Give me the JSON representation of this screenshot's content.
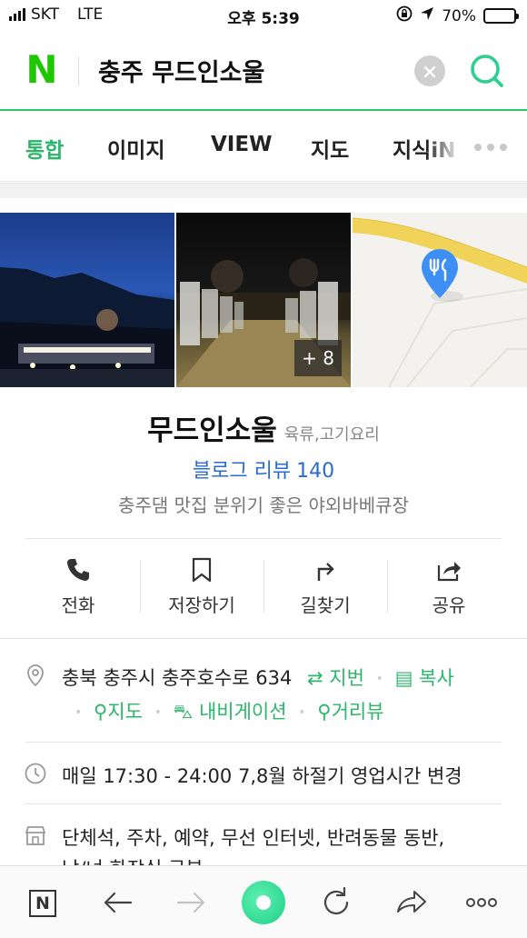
{
  "status_bar": {
    "carrier": "SKT",
    "network": "LTE",
    "time": "오후 5:39",
    "battery": "70%",
    "battery_level": 0.7
  },
  "search": {
    "logo": "N",
    "query": "충주 무드인소울"
  },
  "tabs": [
    {
      "label": "통합",
      "active": true
    },
    {
      "label": "이미지"
    },
    {
      "label": "VIEW"
    },
    {
      "label": "지도"
    },
    {
      "label": "지식iN"
    }
  ],
  "photos": {
    "more_count": "+ 8"
  },
  "place": {
    "name": "무드인소울",
    "category": "육류,고기요리",
    "blog_review_label": "블로그 리뷰",
    "blog_review_count": "140",
    "description": "충주댐 맛집 분위기 좋은 야외바베큐장"
  },
  "actions": [
    {
      "label": "전화",
      "icon": "phone-icon"
    },
    {
      "label": "저장하기",
      "icon": "bookmark-icon"
    },
    {
      "label": "길찾기",
      "icon": "directions-icon"
    },
    {
      "label": "공유",
      "icon": "share-icon"
    }
  ],
  "info": {
    "address": "충북 충주시 충주호수로 634",
    "jibun": "지번",
    "copy": "복사",
    "map": "지도",
    "navigation": "내비게이션",
    "street_view": "거리뷰",
    "hours": "매일 17:30 - 24:00 7,8월 하절기 영업시간 변경",
    "amenities_line1": "단체석, 주차, 예약, 무선 인터넷, 반려동물 동반,",
    "amenities_line2": "남/녀 화장실 구분"
  },
  "colors": {
    "brand_green": "#1ec800",
    "accent_green": "#2bb66a",
    "link_blue": "#2a6bd0"
  }
}
